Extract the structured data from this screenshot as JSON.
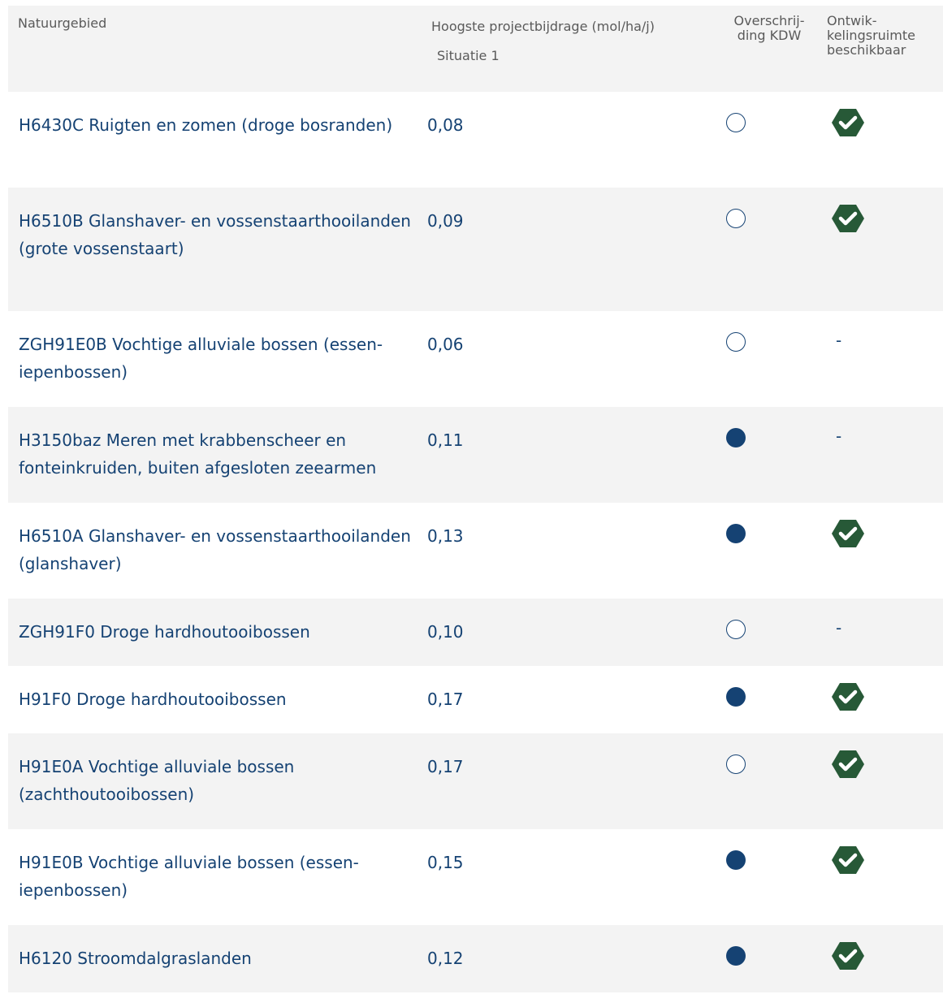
{
  "header": {
    "name": "Natuurgebied",
    "bijdrage": "Hoogste projectbijdrage (mol/ha/j)",
    "situatie": "Situatie 1",
    "kdw": "Overschrij-\nding KDW",
    "ruimte": "Ontwik-\nkelingsruimte\nbeschikbaar"
  },
  "colors": {
    "text": "#154273",
    "marker": "#154273",
    "check": "#275937",
    "stripe": "#f3f3f3",
    "header_text": "#5a5a5a"
  },
  "rows": [
    {
      "name": "H6430C Ruigten en zomen (droge bosranden)",
      "value": "0,08",
      "kdw": "open",
      "ruimte": "check-icon"
    },
    {
      "name": "H6510B Glanshaver- en vossenstaarthooilanden (grote vossenstaart)",
      "value": "0,09",
      "kdw": "open",
      "ruimte": "check-icon"
    },
    {
      "name": "ZGH91E0B Vochtige alluviale bossen (essen-iepenbossen)",
      "value": "0,06",
      "kdw": "open",
      "ruimte": "-"
    },
    {
      "name": "H3150baz Meren met krabbenscheer en fonteinkruiden, buiten afgesloten zeearmen",
      "value": "0,11",
      "kdw": "filled",
      "ruimte": "-"
    },
    {
      "name": "H6510A Glanshaver- en vossenstaarthooilanden (glanshaver)",
      "value": "0,13",
      "kdw": "filled",
      "ruimte": "check-icon"
    },
    {
      "name": "ZGH91F0 Droge hardhoutooibossen",
      "value": "0,10",
      "kdw": "open",
      "ruimte": "-"
    },
    {
      "name": "H91F0 Droge hardhoutooibossen",
      "value": "0,17",
      "kdw": "filled",
      "ruimte": "check-icon"
    },
    {
      "name": "H91E0A Vochtige alluviale bossen (zachthoutooibossen)",
      "value": "0,17",
      "kdw": "open",
      "ruimte": "check-icon"
    },
    {
      "name": "H91E0B Vochtige alluviale bossen (essen-iepenbossen)",
      "value": "0,15",
      "kdw": "filled",
      "ruimte": "check-icon"
    },
    {
      "name": "H6120 Stroomdalgraslanden",
      "value": "0,12",
      "kdw": "filled",
      "ruimte": "check-icon"
    }
  ]
}
